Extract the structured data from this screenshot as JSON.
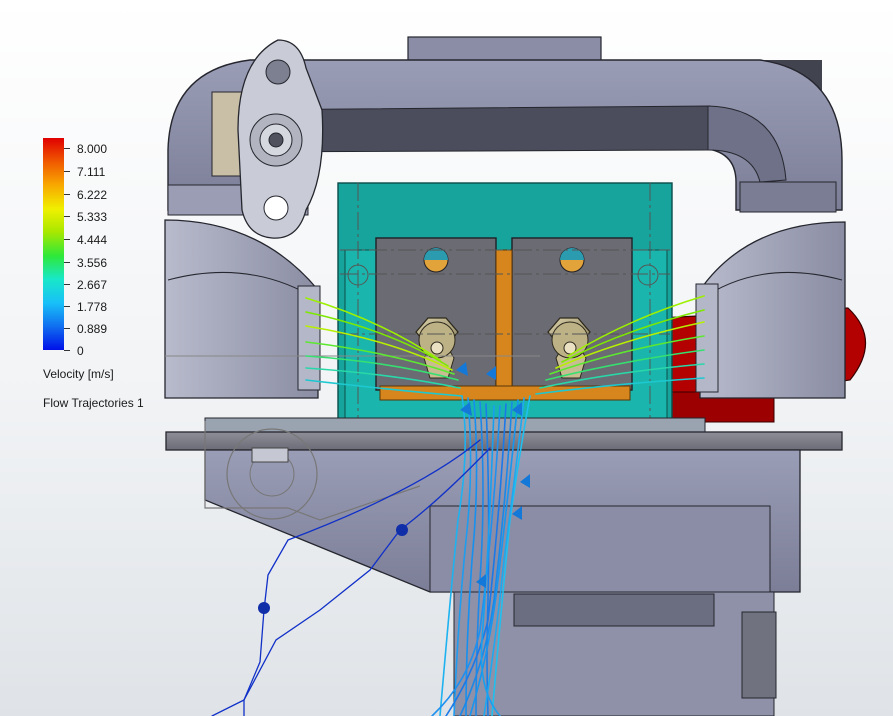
{
  "legend": {
    "ticks": [
      "8.000",
      "7.111",
      "6.222",
      "5.333",
      "4.444",
      "3.556",
      "2.667",
      "1.778",
      "0.889",
      "0"
    ],
    "colors": [
      "#e00000",
      "#f05a00",
      "#f8a800",
      "#f0f000",
      "#a8e800",
      "#2ee83a",
      "#18e8c8",
      "#18c0f8",
      "#1070f0",
      "#0010e8"
    ],
    "unit_label": "Velocity [m/s]",
    "plot_name": "Flow Trajectories 1"
  },
  "model": {
    "body_color": "#868aa4",
    "body_dark": "#5c5f74",
    "enclosure_color": "#1aa8a0",
    "heatsink_color": "#d6861c",
    "fan_color": "#b40000"
  }
}
